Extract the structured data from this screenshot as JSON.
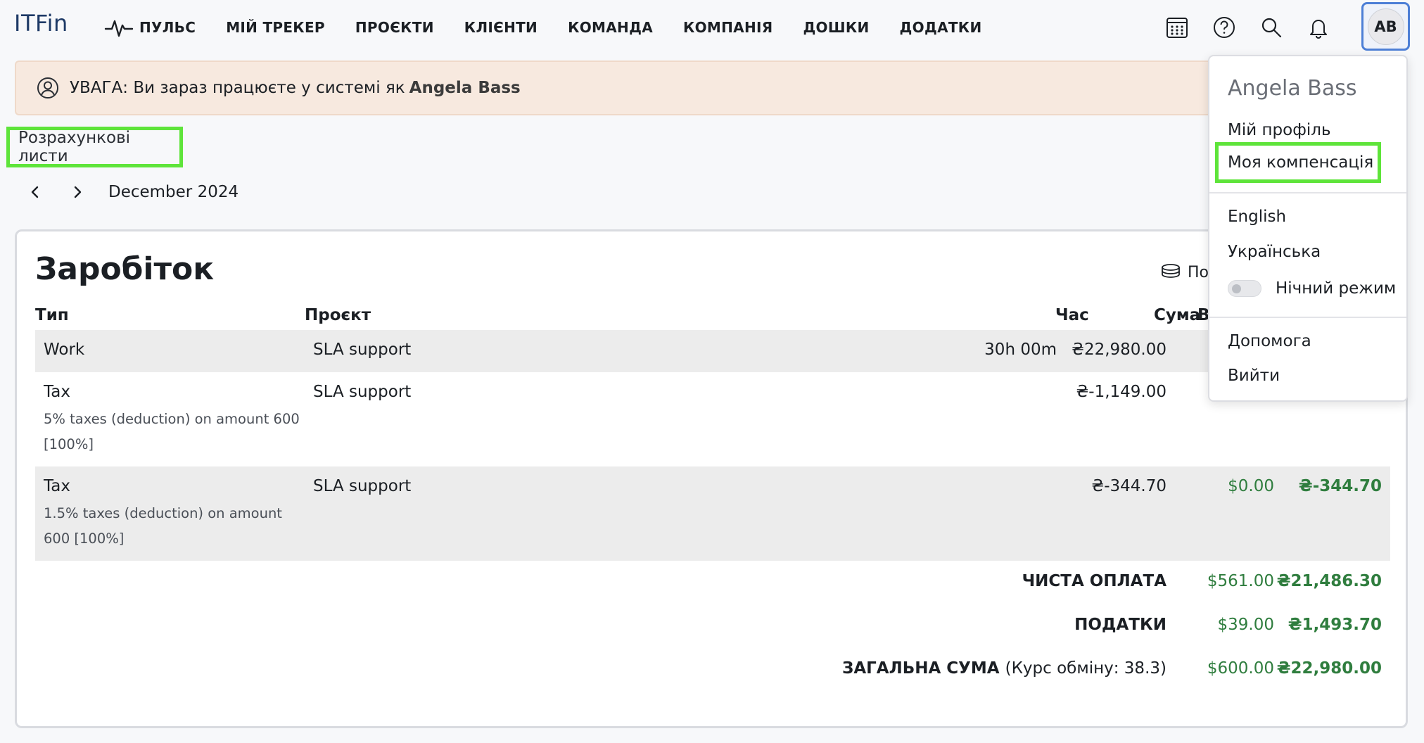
{
  "app": {
    "logo": "ITFin"
  },
  "nav": {
    "items": [
      {
        "label": "ПУЛЬС"
      },
      {
        "label": "МІЙ ТРЕКЕР"
      },
      {
        "label": "ПРОЄКТИ"
      },
      {
        "label": "КЛІЄНТИ"
      },
      {
        "label": "КОМАНДА"
      },
      {
        "label": "КОМПАНІЯ"
      },
      {
        "label": "ДОШКИ"
      },
      {
        "label": "ДОДАТКИ"
      }
    ],
    "icons": [
      "calendar-icon",
      "help-icon",
      "search-icon",
      "bell-icon"
    ],
    "avatar_initials": "AB"
  },
  "banner": {
    "text": "УВАГА: Ви зараз працюєте у системі як",
    "user": "Angela Bass"
  },
  "page": {
    "title": "Розрахункові листи",
    "month": "December 2024"
  },
  "earnings": {
    "title": "Заробіток",
    "action_label": "По",
    "columns": {
      "type": "Тип",
      "project": "Проєкт",
      "time": "Час",
      "amount": "Сума",
      "total": "Всь"
    },
    "rows": [
      {
        "type": "Work",
        "note": "",
        "project": "SLA support",
        "time": "30h 00m",
        "amount": "₴22,980.00",
        "usd": "",
        "uah": ""
      },
      {
        "type": "Tax",
        "note": "5% taxes (deduction) on amount 600 [100%]",
        "project": "SLA support",
        "time": "",
        "amount": "₴-1,149.00",
        "usd": "",
        "uah": ""
      },
      {
        "type": "Tax",
        "note": "1.5% taxes (deduction) on amount 600 [100%]",
        "project": "SLA support",
        "time": "",
        "amount": "₴-344.70",
        "usd": "$0.00",
        "uah": "₴-344.70"
      }
    ],
    "totals": [
      {
        "label": "ЧИСТА ОПЛАТА",
        "extra": "",
        "usd": "$561.00",
        "uah": "₴21,486.30"
      },
      {
        "label": "ПОДАТКИ",
        "extra": "",
        "usd": "$39.00",
        "uah": "₴1,493.70"
      },
      {
        "label": "ЗАГАЛЬНА СУМА",
        "extra": "(Курс обміну: 38.3)",
        "usd": "$600.00",
        "uah": "₴22,980.00"
      }
    ]
  },
  "dropdown": {
    "user_name": "Angela Bass",
    "profile": "Мій профіль",
    "compensation": "Моя компенсація",
    "lang_en": "English",
    "lang_uk": "Українська",
    "night_mode": "Нічний режим",
    "night_mode_on": false,
    "help": "Допомога",
    "logout": "Вийти"
  },
  "colors": {
    "accent_highlight": "#5ee43a",
    "money_green": "#2f7d3e",
    "avatar_ring": "#4d7fd6",
    "banner_bg": "#f7e9df"
  }
}
